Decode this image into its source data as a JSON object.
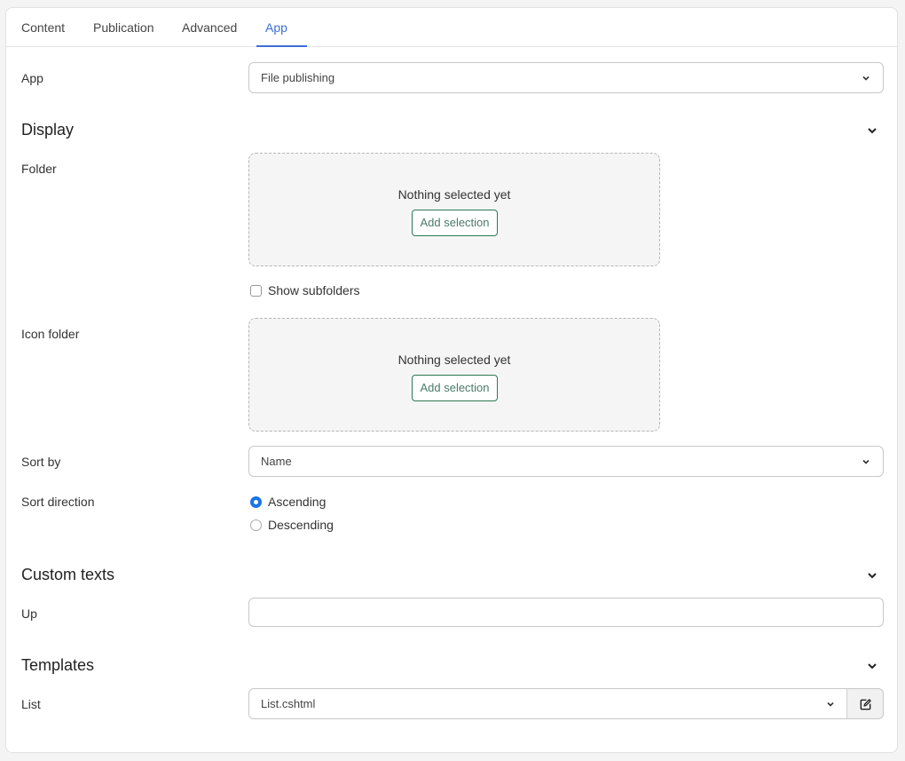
{
  "tabs": [
    {
      "label": "Content",
      "active": false
    },
    {
      "label": "Publication",
      "active": false
    },
    {
      "label": "Advanced",
      "active": false
    },
    {
      "label": "App",
      "active": true
    }
  ],
  "app_field": {
    "label": "App",
    "value": "File publishing"
  },
  "display": {
    "title": "Display",
    "folder": {
      "label": "Folder",
      "empty_text": "Nothing selected yet",
      "button": "Add selection"
    },
    "show_subfolders": {
      "label": "Show subfolders",
      "checked": false
    },
    "icon_folder": {
      "label": "Icon folder",
      "empty_text": "Nothing selected yet",
      "button": "Add selection"
    },
    "sort_by": {
      "label": "Sort by",
      "value": "Name"
    },
    "sort_direction": {
      "label": "Sort direction",
      "options": [
        {
          "label": "Ascending",
          "checked": true
        },
        {
          "label": "Descending",
          "checked": false
        }
      ]
    }
  },
  "custom_texts": {
    "title": "Custom texts",
    "up": {
      "label": "Up",
      "value": ""
    }
  },
  "templates": {
    "title": "Templates",
    "list": {
      "label": "List",
      "value": "List.cshtml"
    }
  },
  "colors": {
    "accent": "#3b6fd6",
    "radio": "#1a73e8",
    "button_border": "#2a7a55"
  }
}
